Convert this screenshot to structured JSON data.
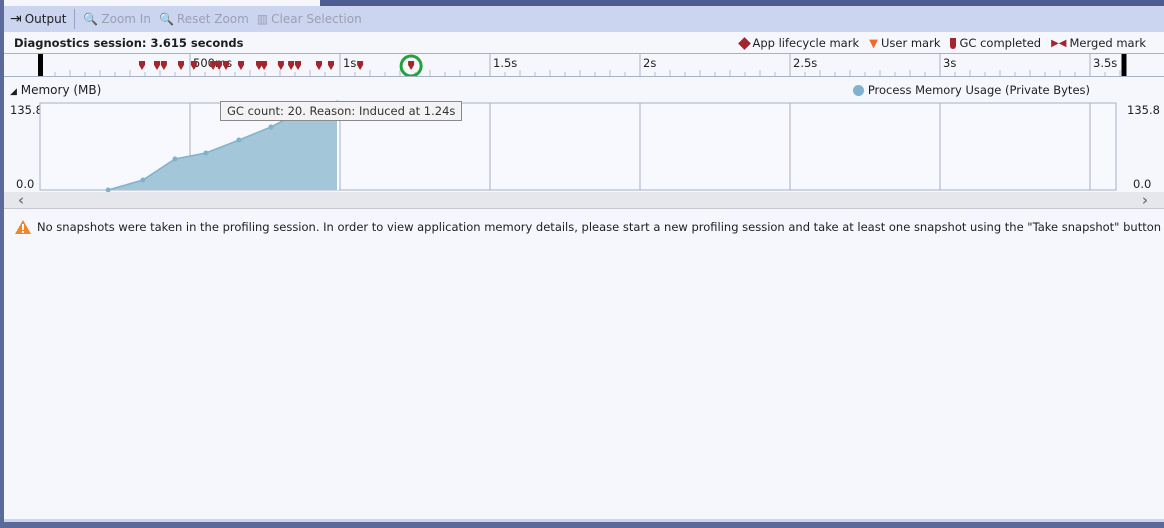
{
  "toolbar": {
    "output": "Output",
    "zoom_in": "Zoom In",
    "reset_zoom": "Reset Zoom",
    "clear_selection": "Clear Selection"
  },
  "session": "Diagnostics session: 3.615 seconds",
  "legend": {
    "app_lifecycle": "App lifecycle mark",
    "user_mark": "User mark",
    "gc_completed": "GC completed",
    "merged_mark": "Merged mark"
  },
  "ruler": {
    "duration_s": 3.615,
    "labels": [
      {
        "t": 0.5,
        "text": "500ms"
      },
      {
        "t": 1,
        "text": "1s"
      },
      {
        "t": 1.5,
        "text": "1.5s"
      },
      {
        "t": 2,
        "text": "2s"
      },
      {
        "t": 2.5,
        "text": "2.5s"
      },
      {
        "t": 3,
        "text": "3s"
      },
      {
        "t": 3.5,
        "text": "3.5s"
      }
    ],
    "gc_marks_s": [
      0.34,
      0.39,
      0.413,
      0.47,
      0.513,
      0.577,
      0.597,
      0.62,
      0.67,
      0.73,
      0.747,
      0.803,
      0.837,
      0.86,
      0.93,
      0.97,
      1.067,
      1.237
    ],
    "highlighted_mark_s": 1.237
  },
  "memory": {
    "title": "Memory (MB)",
    "legend": "Process Memory Usage (Private Bytes)",
    "ymax_label": "135.8",
    "ymin_label": "0.0",
    "ymax": 135.8,
    "points": [
      [
        0.227,
        0
      ],
      [
        0.343,
        15.6
      ],
      [
        0.45,
        48.4
      ],
      [
        0.553,
        57.8
      ],
      [
        0.663,
        78
      ],
      [
        0.77,
        98.4
      ],
      [
        0.88,
        125
      ],
      [
        0.99,
        135.8
      ]
    ],
    "series_color": "#7fb2cc"
  },
  "tooltip": "GC count: 20. Reason: Induced at 1.24s",
  "warning": "No snapshots were taken in the profiling session. In order to view application memory details, please start a new profiling session and take at least one snapshot using the \"Take snapshot\" button"
}
